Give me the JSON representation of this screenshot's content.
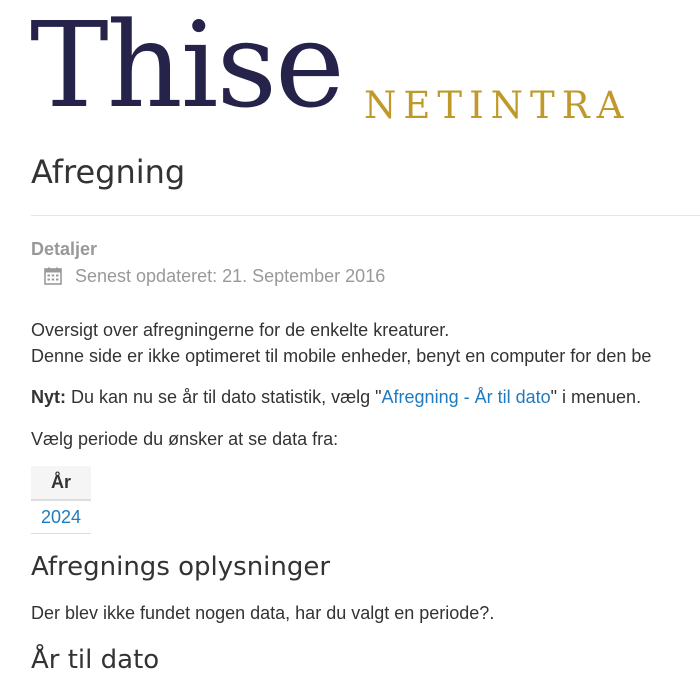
{
  "logo": {
    "main": "Thise",
    "sub": "NETINTRA"
  },
  "page": {
    "title": "Afregning"
  },
  "details": {
    "label": "Detaljer",
    "updated": "Senest opdateret: 21. September 2016",
    "icon": "calendar-icon"
  },
  "intro": {
    "line1": "Oversigt over afregningerne for de enkelte kreaturer.",
    "line2": "Denne side er ikke optimeret til mobile enheder, benyt en computer for den be"
  },
  "news": {
    "label": "Nyt:",
    "text_before": " Du kan nu se år til dato statistik, vælg \"",
    "link": "Afregning - År til dato",
    "text_after": "\" i menuen."
  },
  "period": {
    "prompt": "Vælg periode du ønsker at se data fra:",
    "column_header": "År",
    "years": [
      "2024"
    ]
  },
  "settlement": {
    "title": "Afregnings oplysninger",
    "message": "Der blev ikke fundet nogen data, har du valgt en periode?."
  },
  "ytd": {
    "title": "År til dato"
  },
  "colors": {
    "logo_main": "#25234a",
    "logo_sub": "#bf9a2a",
    "link": "#1f7bbf",
    "muted": "#999999"
  }
}
